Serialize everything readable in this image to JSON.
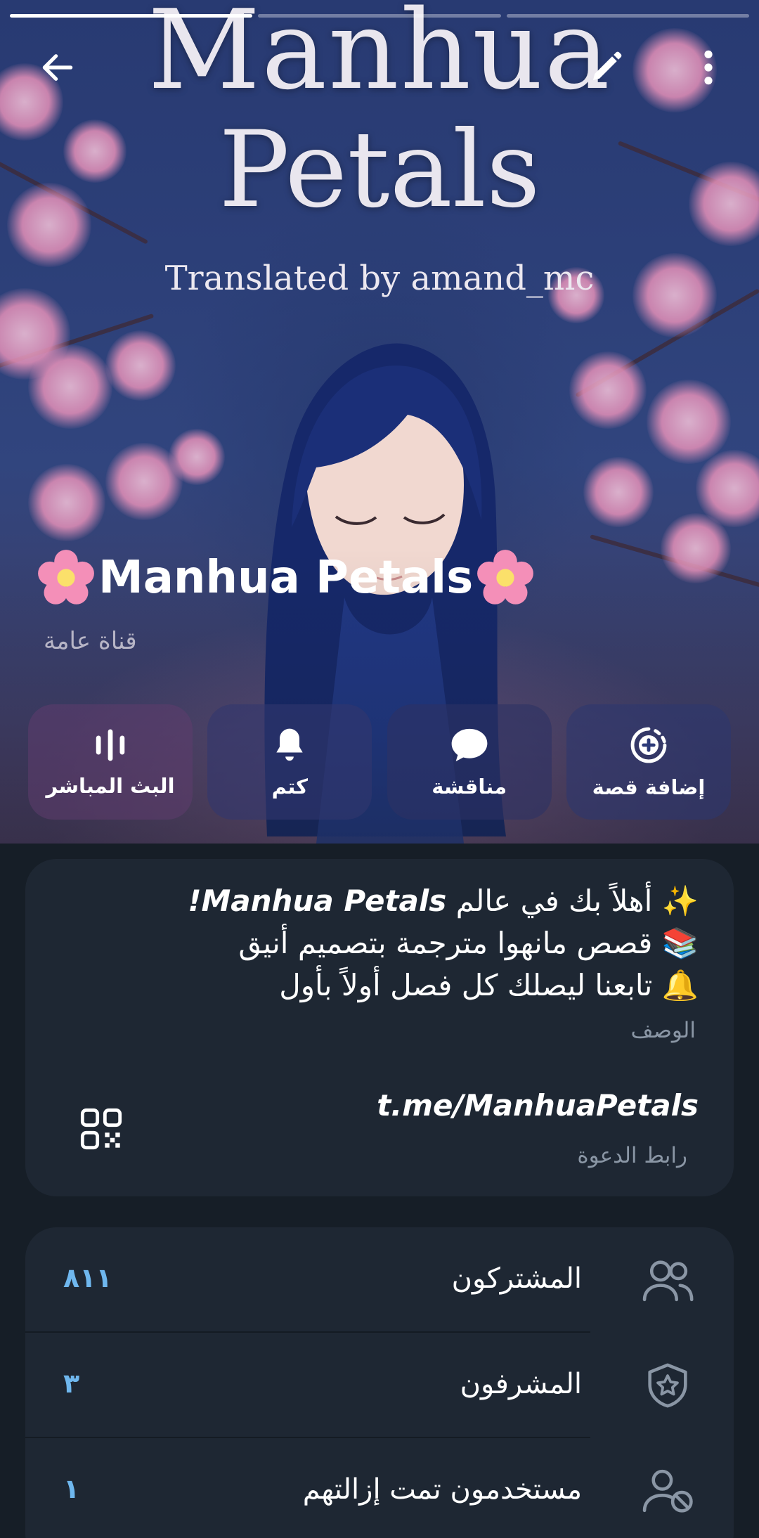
{
  "header": {
    "back_icon": "arrow-left-icon",
    "edit_icon": "pencil-icon",
    "more_icon": "more-vertical-icon"
  },
  "story_progress": {
    "segments": 3,
    "active": 1
  },
  "cover": {
    "title_line1": "Manhua",
    "title_line2": "Petals",
    "subtitle": "Translated by amand_mc"
  },
  "channel": {
    "name": "🌸Manhua Petals🌸",
    "name_text": "Manhua Petals",
    "type": "قناة عامة"
  },
  "actions": [
    {
      "label": "البث المباشر",
      "icon": "live-stream-icon"
    },
    {
      "label": "كتم",
      "icon": "bell-icon"
    },
    {
      "label": "مناقشة",
      "icon": "chat-bubble-icon"
    },
    {
      "label": "إضافة قصة",
      "icon": "add-story-icon"
    }
  ],
  "info": {
    "description_lines": [
      {
        "emoji": "✨",
        "text": "أهلاً بك في عالم ",
        "em": "Manhua Petals!"
      },
      {
        "emoji": "📚",
        "text": "قصص مانهوا مترجمة بتصميم أنيق",
        "em": ""
      },
      {
        "emoji": "🔔",
        "text": "تابعنا ليصلك كل فصل أولاً بأول",
        "em": ""
      }
    ],
    "description_label": "الوصف",
    "invite_link": "t.me/ManhuaPetals",
    "invite_label": "رابط الدعوة",
    "qr_icon": "qr-code-icon"
  },
  "stats": [
    {
      "label": "المشتركون",
      "count": "٨١١",
      "icon": "users-icon"
    },
    {
      "label": "المشرفون",
      "count": "٣",
      "icon": "admin-shield-icon"
    },
    {
      "label": "مستخدمون تمت إزالتهم",
      "count": "١",
      "icon": "user-removed-icon"
    }
  ],
  "colors": {
    "background": "#161e27",
    "card": "#1e2733",
    "accent_count": "#6fb7ee",
    "secondary_text": "#8a96a5"
  }
}
